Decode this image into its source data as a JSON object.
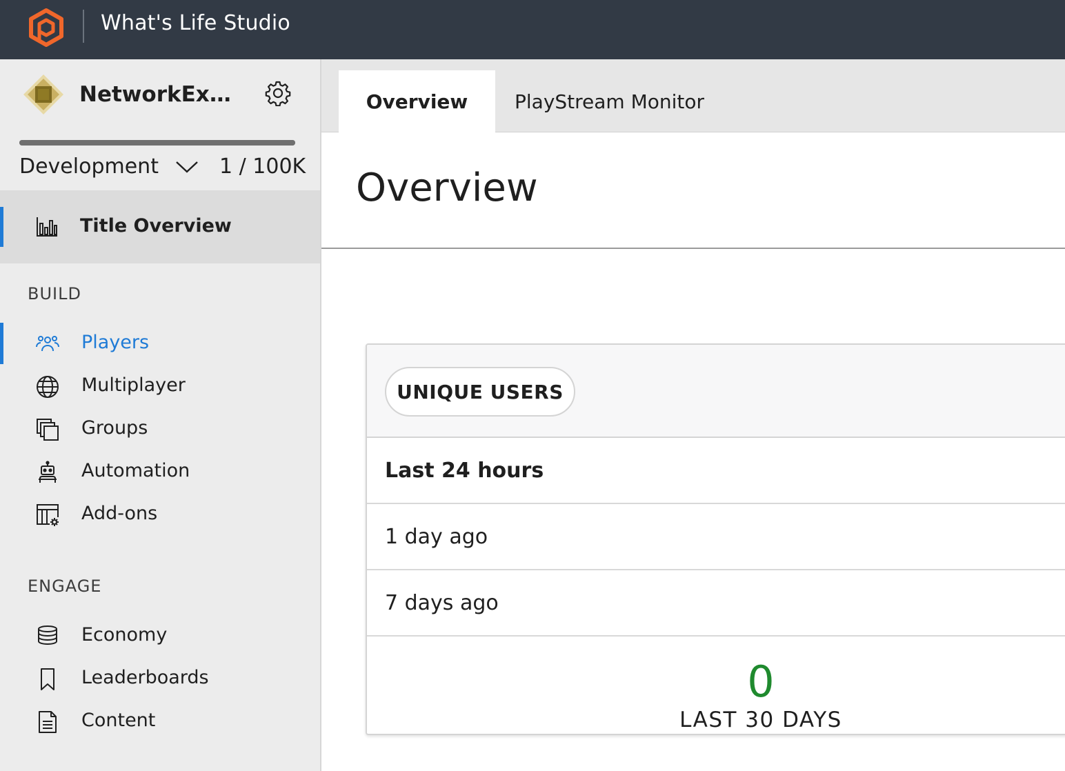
{
  "app": {
    "studio_name": "What's Life Studio"
  },
  "sidebar": {
    "title_name": "NetworkExam...",
    "environment": "Development",
    "player_count": "1 / 100K",
    "usage_fraction": 1.0,
    "active_item": {
      "label": "Title Overview",
      "icon": "bar-chart-icon"
    },
    "sections": [
      {
        "label": "BUILD",
        "items": [
          {
            "label": "Players",
            "icon": "players-icon",
            "selected": true
          },
          {
            "label": "Multiplayer",
            "icon": "globe-icon"
          },
          {
            "label": "Groups",
            "icon": "groups-icon"
          },
          {
            "label": "Automation",
            "icon": "robot-icon"
          },
          {
            "label": "Add-ons",
            "icon": "addons-icon"
          }
        ]
      },
      {
        "label": "ENGAGE",
        "items": [
          {
            "label": "Economy",
            "icon": "coins-icon"
          },
          {
            "label": "Leaderboards",
            "icon": "bookmark-icon"
          },
          {
            "label": "Content",
            "icon": "document-icon"
          }
        ]
      }
    ]
  },
  "tabs": [
    {
      "label": "Overview",
      "active": true
    },
    {
      "label": "PlayStream Monitor",
      "active": false
    }
  ],
  "main": {
    "page_title": "Overview"
  },
  "card": {
    "pill_label": "UNIQUE USERS",
    "rows": [
      "Last 24 hours",
      "1 day ago",
      "7 days ago"
    ],
    "metric_value": "0",
    "metric_label": "LAST 30 DAYS"
  },
  "colors": {
    "topbar": "#323a45",
    "accent": "#1f7bd6",
    "logo_orange": "#f0672b",
    "metric_green": "#1f8a2e"
  }
}
